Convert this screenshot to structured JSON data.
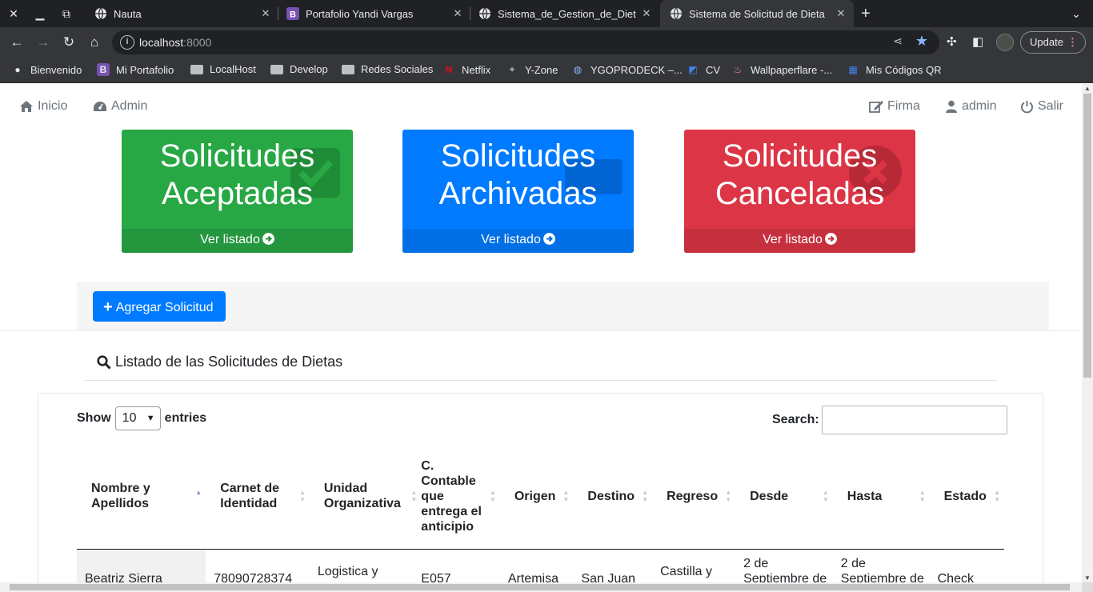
{
  "browser": {
    "tabs": [
      {
        "title": "Nauta",
        "active": false
      },
      {
        "title": "Portafolio Yandi Vargas",
        "active": false
      },
      {
        "title": "Sistema_de_Gestion_de_Diet",
        "active": false
      },
      {
        "title": "Sistema de Solicitud de Dieta",
        "active": true
      }
    ],
    "url_host": "localhost",
    "url_port": ":8000",
    "update_label": "Update",
    "bookmarks": [
      "Bienvenido",
      "Mi Portafolio",
      "LocalHost",
      "Develop",
      "Redes Sociales",
      "Netflix",
      "Y-Zone",
      "YGOPRODECK –...",
      "CV",
      "Wallpaperflare -...",
      "Mis Códigos QR"
    ]
  },
  "nav": {
    "inicio": "Inicio",
    "admin": "Admin",
    "firma": "Firma",
    "user": "admin",
    "salir": "Salir"
  },
  "cards": [
    {
      "line1": "Solicitudes",
      "line2": "Aceptadas",
      "link": "Ver listado",
      "color": "#28a745",
      "foot_color": "#24963e"
    },
    {
      "line1": "Solicitudes",
      "line2": "Archivadas",
      "link": "Ver listado",
      "color": "#007bff",
      "foot_color": "#006fe6"
    },
    {
      "line1": "Solicitudes",
      "line2": "Canceladas",
      "link": "Ver listado",
      "color": "#dc3545",
      "foot_color": "#c6303e"
    }
  ],
  "add_button": "Agregar Solicitud",
  "list_title": "Listado de las Solicitudes de Dietas",
  "table": {
    "show_label": "Show",
    "entries_value": "10",
    "entries_label": "entries",
    "search_label": "Search:",
    "columns": [
      "Nombre y Apellidos",
      "Carnet de Identidad",
      "Unidad Organizativa",
      "C. Contable que entrega el anticipio",
      "Origen",
      "Destino",
      "Regreso",
      "Desde",
      "Hasta",
      "Estado"
    ],
    "rows": [
      [
        "Beatriz Sierra",
        "78090728374",
        "Logistica y",
        "E057",
        "Artemisa",
        "San Juan",
        "Castilla y",
        "2 de Septiembre de",
        "2 de Septiembre de",
        "Check"
      ]
    ]
  }
}
